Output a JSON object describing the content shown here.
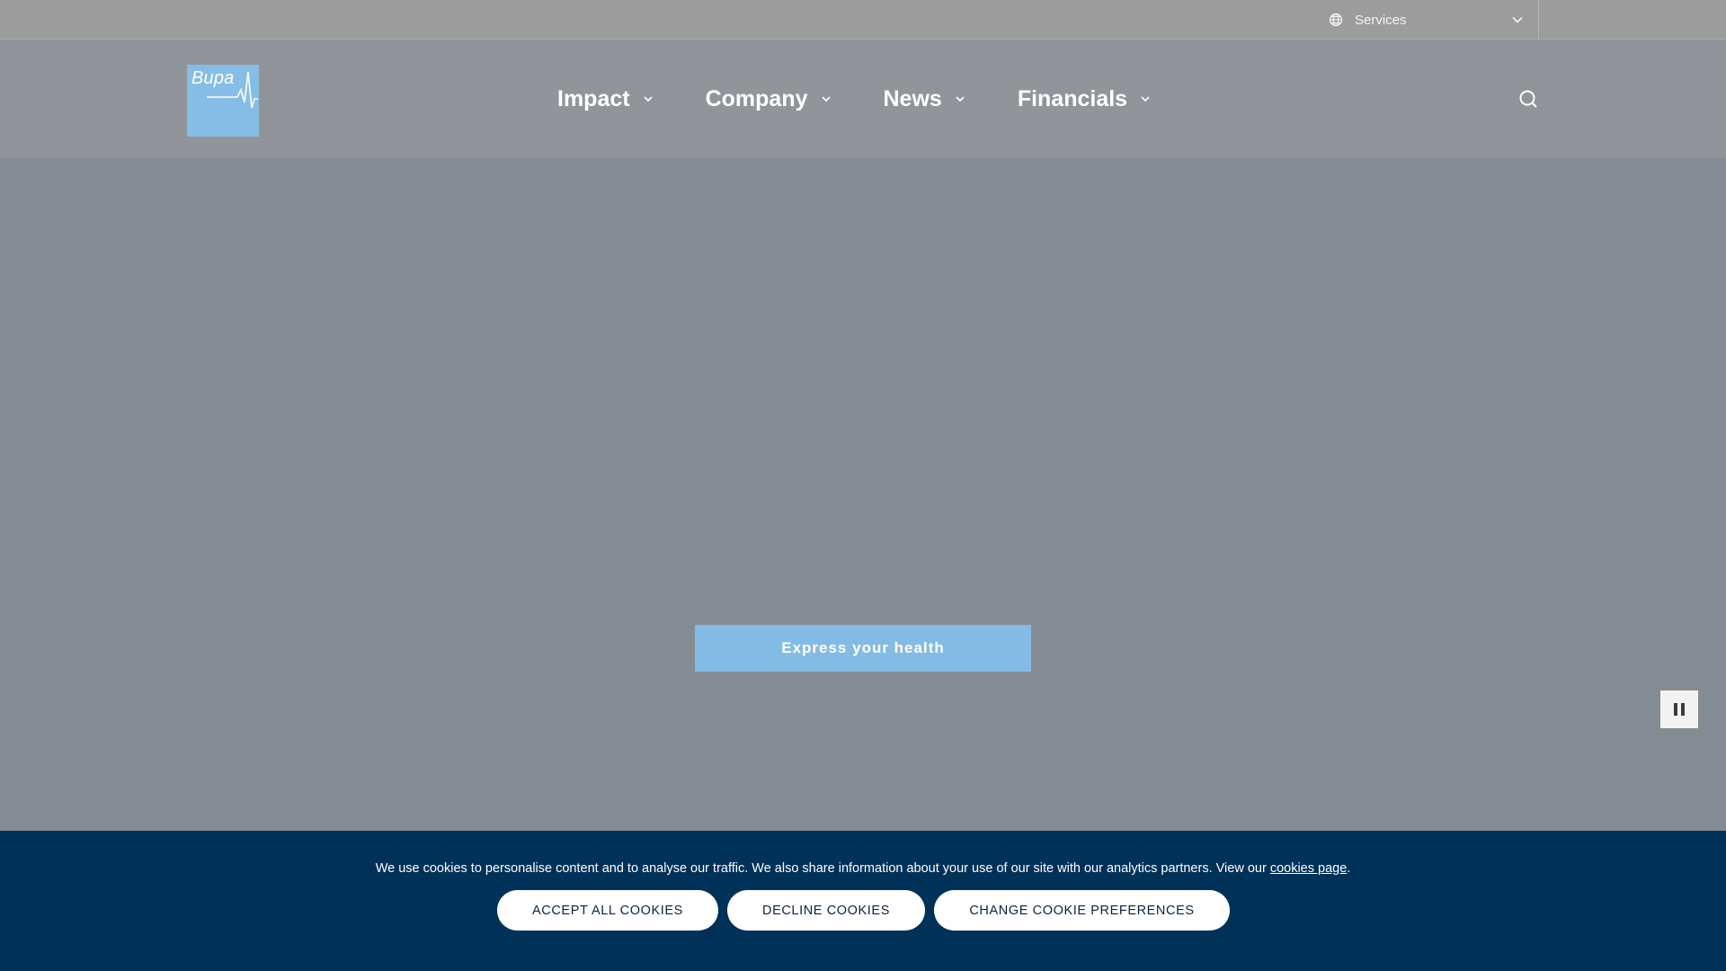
{
  "utility": {
    "services_label": "Services"
  },
  "header": {
    "logo_text": "Bupa",
    "nav": [
      {
        "label": "Impact"
      },
      {
        "label": "Company"
      },
      {
        "label": "News"
      },
      {
        "label": "Financials"
      }
    ]
  },
  "hero": {
    "cta_label": "Express your health"
  },
  "cookie": {
    "text": "We use cookies to personalise content and to analyse our traffic. We also share information about your use of our site with our analytics partners. View our ",
    "link_label": "cookies page",
    "text_end": ".",
    "accept_label": "ACCEPT ALL COOKIES",
    "decline_label": "DECLINE COOKIES",
    "change_label": "CHANGE COOKIE PREFERENCES"
  },
  "colors": {
    "brand_blue": "#85bde6",
    "banner_navy": "#003159"
  }
}
